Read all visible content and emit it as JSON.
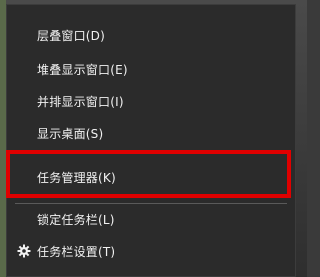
{
  "context_menu": {
    "items": [
      {
        "label": "层叠窗口(D)"
      },
      {
        "label": "堆叠显示窗口(E)"
      },
      {
        "label": "并排显示窗口(I)"
      },
      {
        "label": "显示桌面(S)"
      },
      {
        "label": "任务管理器(K)"
      },
      {
        "label": "锁定任务栏(L)"
      },
      {
        "label": "任务栏设置(T)",
        "icon": "gear-icon"
      }
    ]
  },
  "colors": {
    "menu_background": "#2b2b2b",
    "text": "#f2f2f2",
    "separator": "#5a5a5a",
    "highlight_box": "#e00000"
  }
}
